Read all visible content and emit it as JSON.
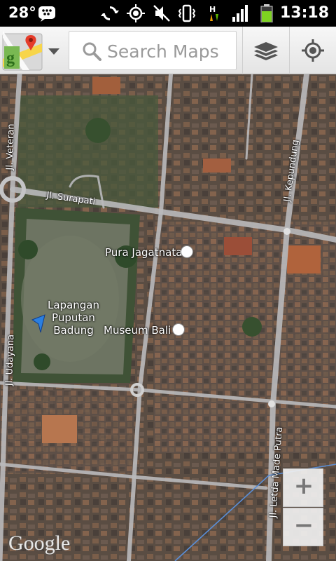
{
  "status_bar": {
    "temperature": "28°",
    "time": "13:18",
    "icons": [
      "blackberry-messenger-icon",
      "sync-icon",
      "gps-icon",
      "mute-icon",
      "vibrate-icon",
      "hsdpa-data-icon",
      "signal-icon",
      "battery-icon"
    ]
  },
  "action_bar": {
    "logo_icon": "google-maps-logo-icon",
    "dropdown_icon": "chevron-down-icon",
    "search_placeholder": "Search Maps",
    "layers_icon": "layers-icon",
    "my_location_icon": "my-location-icon"
  },
  "map": {
    "roads": {
      "veteran": "Jl. Veteran",
      "surapati": "Jl. Surapati",
      "kepundung": "Jl. Kepundung",
      "udayana": "Jl. Udayana",
      "letda": "Jl. Letda Made Putra"
    },
    "pois": {
      "pura": "Pura Jagatnata",
      "museum": "Museum Bali",
      "lapangan_line1": "Lapangan",
      "lapangan_line2": "Puputan",
      "lapangan_line3": "Badung"
    },
    "zoom_in": "+",
    "zoom_out": "−",
    "attribution": "Google"
  }
}
